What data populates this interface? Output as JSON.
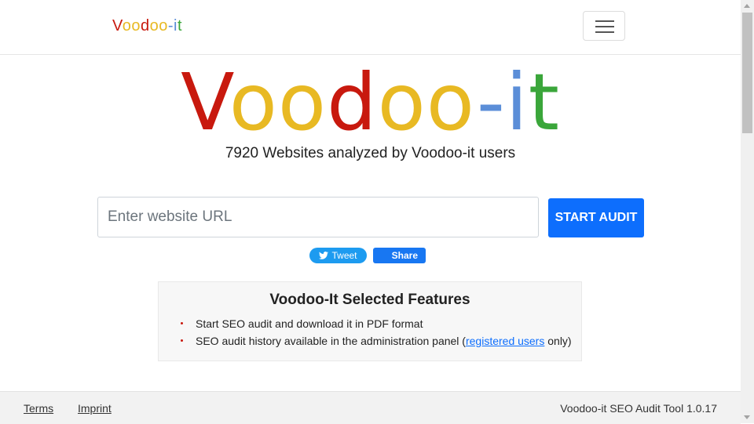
{
  "brand": {
    "small_letters": [
      {
        "ch": "V",
        "color": "#c8190e"
      },
      {
        "ch": "o",
        "color": "#e8b923"
      },
      {
        "ch": "o",
        "color": "#e8b923"
      },
      {
        "ch": "d",
        "color": "#c8190e"
      },
      {
        "ch": "o",
        "color": "#e8b923"
      },
      {
        "ch": "o",
        "color": "#e8b923"
      },
      {
        "ch": "-",
        "color": "#5b8ed8"
      },
      {
        "ch": "i",
        "color": "#5b8ed8"
      },
      {
        "ch": "t",
        "color": "#3aa63a"
      }
    ]
  },
  "hero": {
    "stats": "7920 Websites analyzed by Voodoo-it users"
  },
  "form": {
    "url_placeholder": "Enter website URL",
    "url_value": "",
    "start_label": "START AUDIT"
  },
  "social": {
    "tweet_label": "Tweet",
    "share_label": "Share"
  },
  "features": {
    "title": "Voodoo-It Selected Features",
    "item1": "Start SEO audit and download it in PDF format",
    "item2_prefix": "SEO audit history available in the administration panel (",
    "item2_link": "registered users",
    "item2_suffix": " only)"
  },
  "footer": {
    "terms": "Terms",
    "imprint": "Imprint",
    "version": "Voodoo-it SEO Audit Tool 1.0.17"
  },
  "colors": {
    "red": "#c8190e",
    "yellow": "#e8b923",
    "blue": "#5b8ed8",
    "green": "#3aa63a",
    "primary": "#0d6efd"
  },
  "icons": {
    "menu": "hamburger-menu-icon",
    "twitter": "twitter-bird-icon"
  }
}
